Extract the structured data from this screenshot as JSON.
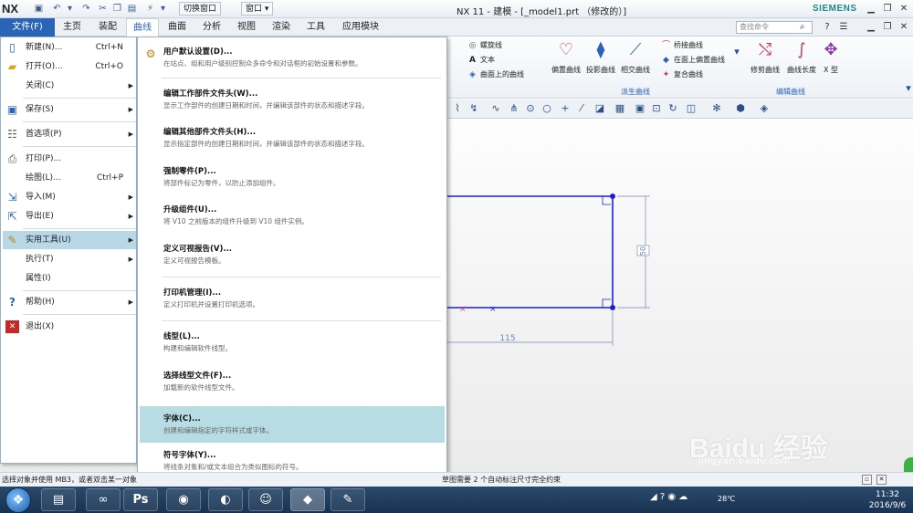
{
  "app": {
    "logo": "NX",
    "window_title": "NX 11 - 建模 - [_model1.prt （修改的）]",
    "brand": "SIEMENS",
    "quick_access": {
      "switch_window": "切换窗口",
      "window": "窗口"
    }
  },
  "tabs": {
    "file": "文件(F)",
    "items": [
      "主页",
      "装配",
      "曲线",
      "曲面",
      "分析",
      "视图",
      "渲染",
      "工具",
      "应用模块"
    ],
    "active": "曲线"
  },
  "search": {
    "placeholder": "查找命令"
  },
  "ribbon": {
    "small": [
      "螺旋线",
      "文本",
      "曲面上的曲线",
      "桥接曲线",
      "在面上偏置曲线",
      "复合曲线"
    ],
    "big": [
      "偏置曲线",
      "投影曲线",
      "相交曲线",
      "修剪曲线",
      "曲线长度",
      "X 型"
    ],
    "groups": [
      "派生曲线",
      "编辑曲线"
    ]
  },
  "file_menu": [
    {
      "label": "新建(N)...",
      "shortcut": "Ctrl+N",
      "icon": "new-file-icon"
    },
    {
      "label": "打开(O)...",
      "shortcut": "Ctrl+O",
      "icon": "open-folder-icon"
    },
    {
      "label": "关闭(C)",
      "submenu": true
    },
    {
      "label": "保存(S)",
      "submenu": true,
      "icon": "save-icon"
    },
    {
      "label": "首选项(P)",
      "submenu": true,
      "icon": "preferences-icon"
    },
    {
      "label": "打印(P)...",
      "icon": "print-icon"
    },
    {
      "label": "绘图(L)...",
      "shortcut": "Ctrl+P"
    },
    {
      "label": "导入(M)",
      "submenu": true,
      "icon": "import-icon"
    },
    {
      "label": "导出(E)",
      "submenu": true,
      "icon": "export-icon"
    },
    {
      "label": "实用工具(U)",
      "submenu": true,
      "icon": "utilities-icon",
      "highlighted": true
    },
    {
      "label": "执行(T)",
      "submenu": true
    },
    {
      "label": "属性(I)"
    },
    {
      "label": "帮助(H)",
      "submenu": true,
      "icon": "help-icon"
    },
    {
      "label": "退出(X)",
      "icon": "exit-icon"
    }
  ],
  "submenu": [
    {
      "title": "用户默认设置(D)...",
      "desc": "在站点、组和用户级别控制众多命令和对话框的初始设置和参数。"
    },
    {
      "title": "编辑工作部件文件头(W)...",
      "desc": "显示工作部件的创建日期和时间，并编辑该部件的状态和描述字段。"
    },
    {
      "title": "编辑其他部件文件头(H)...",
      "desc": "显示指定部件的创建日期和时间，并编辑该部件的状态和描述字段。"
    },
    {
      "title": "强制零件(P)...",
      "desc": "将部件标记为零件，以防止添加组件。"
    },
    {
      "title": "升级组件(U)...",
      "desc": "将 V10 之前版本的组件升级到 V10 组件实例。"
    },
    {
      "title": "定义可视报告(V)...",
      "desc": "定义可视报告模板。"
    },
    {
      "title": "打印机管理(I)...",
      "desc": "定义打印机并设置打印机选项。"
    },
    {
      "title": "线型(L)...",
      "desc": "构建和编辑软件线型。"
    },
    {
      "title": "选择线型文件(F)...",
      "desc": "加载新的软件线型文件。"
    },
    {
      "title": "字体(C)...",
      "desc": "创建和编辑指定的字符样式或字体。",
      "highlighted": true
    },
    {
      "title": "符号字体(Y)...",
      "desc": "将线条对象和/或文本组合为类似图标的符号。"
    }
  ],
  "drawing": {
    "dim_vertical": "50",
    "dim_horizontal": "115"
  },
  "status": {
    "left": "选择对象并使用 MB3，或者双击某一对象",
    "middle": "草图需要 2 个自动标注尺寸完全约束"
  },
  "taskbar": {
    "temperature": "28℃",
    "time": "11:32",
    "date": "2016/9/6"
  },
  "watermark": {
    "main": "Baidu 经验",
    "sub": "jingyan.baidu.com"
  },
  "colors": {
    "accent": "#2a64b6",
    "highlight": "#b8d8e8",
    "sketch": "#1d1dd8"
  }
}
